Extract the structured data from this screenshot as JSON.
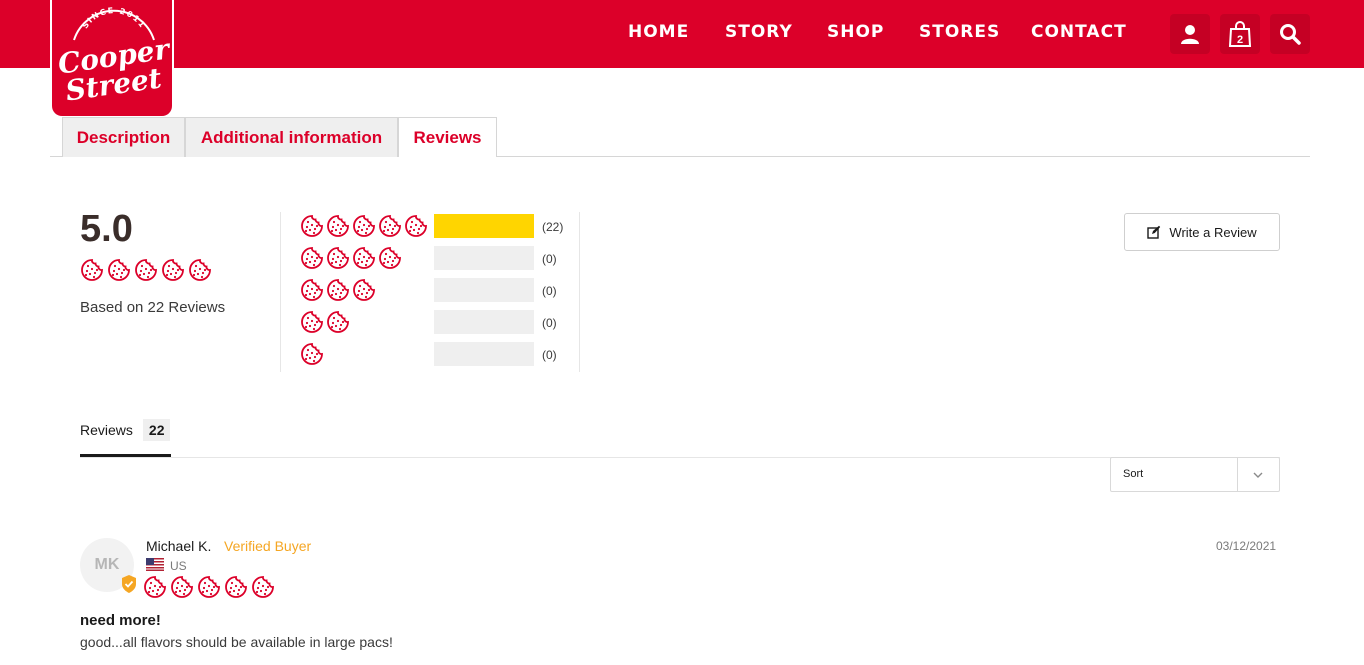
{
  "brand": {
    "since": "SINCE 2011",
    "name_line1": "Cooper",
    "name_line2": "Street",
    "color": "#dc0029"
  },
  "nav": {
    "items": [
      "HOME",
      "STORY",
      "SHOP",
      "STORES",
      "CONTACT"
    ],
    "cart_count": "2",
    "icons": [
      "user-icon",
      "shopping-bag-icon",
      "search-icon"
    ]
  },
  "tabs": {
    "items": [
      {
        "label": "Description",
        "active": false
      },
      {
        "label": "Additional information",
        "active": false
      },
      {
        "label": "Reviews",
        "active": true
      }
    ]
  },
  "summary": {
    "average": "5.0",
    "rating": 5,
    "based_on": "Based on 22 Reviews",
    "histogram": [
      {
        "stars": 5,
        "count_label": "(22)",
        "fraction": 1.0
      },
      {
        "stars": 4,
        "count_label": "(0)",
        "fraction": 0
      },
      {
        "stars": 3,
        "count_label": "(0)",
        "fraction": 0
      },
      {
        "stars": 2,
        "count_label": "(0)",
        "fraction": 0
      },
      {
        "stars": 1,
        "count_label": "(0)",
        "fraction": 0
      }
    ],
    "bar_fill_color": "#ffd500",
    "write_review": "Write a Review"
  },
  "reviews_tab": {
    "label": "Reviews",
    "count": "22"
  },
  "sort": {
    "label": "Sort"
  },
  "review": {
    "initials": "MK",
    "name": "Michael K.",
    "verified": "Verified Buyer",
    "country": "US",
    "date": "03/12/2021",
    "rating": 5,
    "title": "need more!",
    "body": "good...all flavors should be available in large pacs!"
  }
}
